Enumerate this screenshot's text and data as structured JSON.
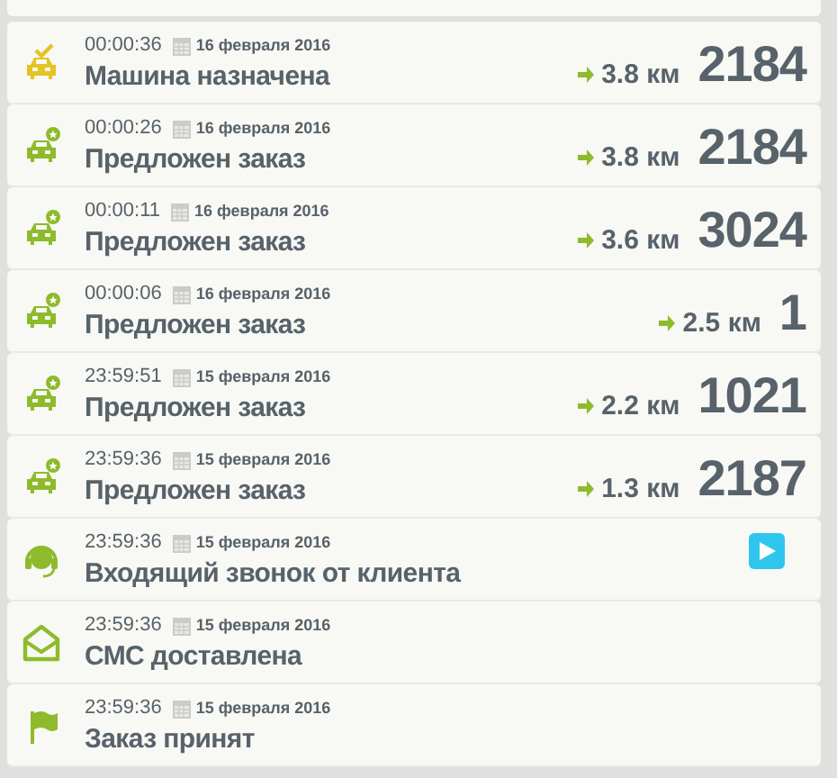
{
  "events": [
    {
      "kind": "assigned",
      "time": "00:00:36",
      "date": "16 февраля 2016",
      "title": "Машина назначена",
      "distance": "3.8 км",
      "number": "2184"
    },
    {
      "kind": "offered",
      "time": "00:00:26",
      "date": "16 февраля 2016",
      "title": "Предложен заказ",
      "distance": "3.8 км",
      "number": "2184"
    },
    {
      "kind": "offered",
      "time": "00:00:11",
      "date": "16 февраля 2016",
      "title": "Предложен заказ",
      "distance": "3.6 км",
      "number": "3024"
    },
    {
      "kind": "offered",
      "time": "00:00:06",
      "date": "16 февраля 2016",
      "title": "Предложен заказ",
      "distance": "2.5 км",
      "number": "1"
    },
    {
      "kind": "offered",
      "time": "23:59:51",
      "date": "15 февраля 2016",
      "title": "Предложен заказ",
      "distance": "2.2 км",
      "number": "1021"
    },
    {
      "kind": "offered",
      "time": "23:59:36",
      "date": "15 февраля 2016",
      "title": "Предложен заказ",
      "distance": "1.3 км",
      "number": "2187"
    },
    {
      "kind": "call",
      "time": "23:59:36",
      "date": "15 февраля 2016",
      "title": "Входящий звонок от клиента",
      "has_recording": true
    },
    {
      "kind": "sms",
      "time": "23:59:36",
      "date": "15 февраля 2016",
      "title": "СМС доставлена"
    },
    {
      "kind": "accepted",
      "time": "23:59:36",
      "date": "15 февраля 2016",
      "title": "Заказ принят"
    }
  ]
}
